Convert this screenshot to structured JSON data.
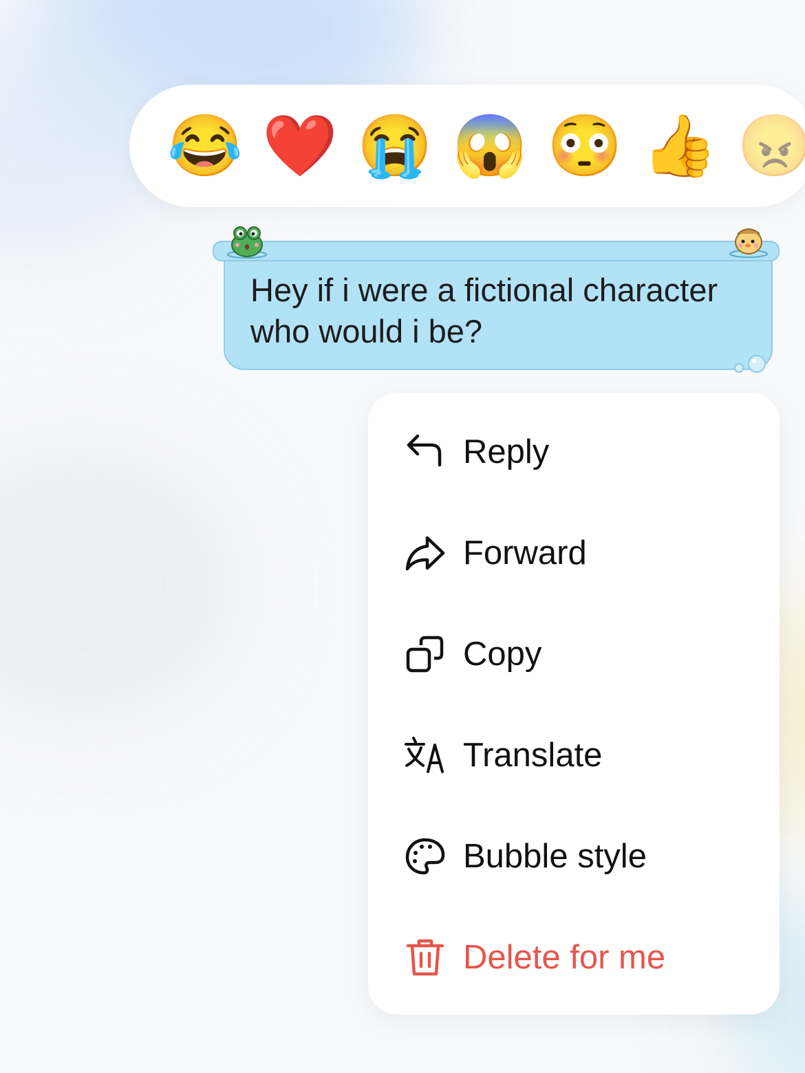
{
  "reactions": [
    {
      "icon": "face-with-tears-of-joy-icon",
      "glyph": "😂"
    },
    {
      "icon": "red-heart-icon",
      "glyph": "❤️"
    },
    {
      "icon": "loudly-crying-face-icon",
      "glyph": "😭"
    },
    {
      "icon": "face-screaming-in-fear-icon",
      "glyph": "😱"
    },
    {
      "icon": "flushed-face-icon",
      "glyph": "😳"
    },
    {
      "icon": "thumbs-up-icon",
      "glyph": "👍"
    },
    {
      "icon": "angry-face-icon",
      "glyph": "😠"
    }
  ],
  "message": {
    "text": "Hey if i were a fictional character who would i be?",
    "bubble_color": "#b2e2f5"
  },
  "menu": {
    "items": [
      {
        "label": "Reply",
        "icon": "reply-arrow-icon"
      },
      {
        "label": "Forward",
        "icon": "forward-arrow-icon"
      },
      {
        "label": "Copy",
        "icon": "copy-icon"
      },
      {
        "label": "Translate",
        "icon": "translate-icon"
      },
      {
        "label": "Bubble style",
        "icon": "palette-icon"
      },
      {
        "label": "Delete for me",
        "icon": "trash-icon"
      }
    ],
    "danger_color": "#e5564b"
  }
}
